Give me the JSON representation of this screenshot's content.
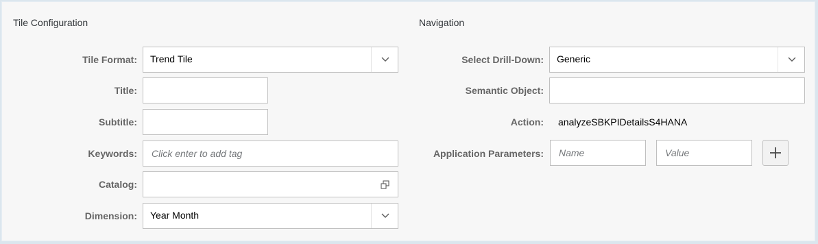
{
  "tile_configuration": {
    "title": "Tile Configuration",
    "tile_format": {
      "label": "Tile Format:",
      "value": "Trend Tile"
    },
    "title_field": {
      "label": "Title:",
      "value": ""
    },
    "subtitle_field": {
      "label": "Subtitle:",
      "value": ""
    },
    "keywords": {
      "label": "Keywords:",
      "placeholder": "Click enter to add tag"
    },
    "catalog": {
      "label": "Catalog:",
      "value": ""
    },
    "dimension": {
      "label": "Dimension:",
      "value": "Year Month"
    }
  },
  "navigation": {
    "title": "Navigation",
    "drill_down": {
      "label": "Select Drill-Down:",
      "value": "Generic"
    },
    "semantic_object": {
      "label": "Semantic Object:",
      "value": ""
    },
    "action": {
      "label": "Action:",
      "value": "analyzeSBKPIDetailsS4HANA"
    },
    "app_params": {
      "label": "Application Parameters:",
      "name_placeholder": "Name",
      "value_placeholder": "Value"
    }
  },
  "icons": {
    "dropdown": "chevron-down-icon",
    "value_help": "value-help-icon",
    "add": "plus-icon"
  }
}
